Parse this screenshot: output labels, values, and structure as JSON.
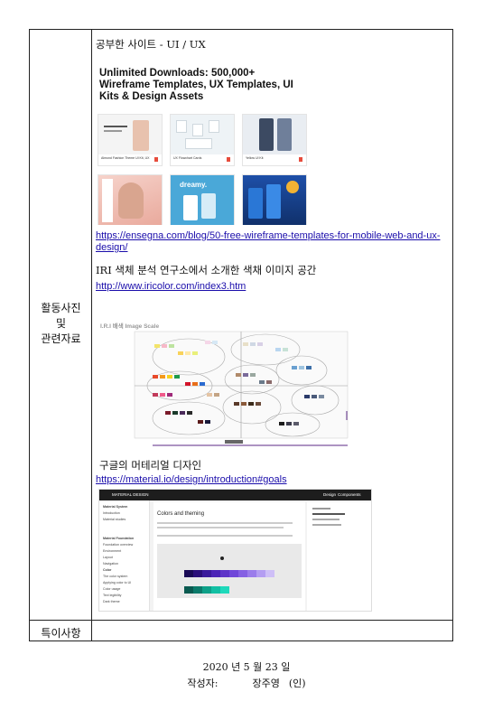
{
  "table": {
    "row_label": [
      "활동사진",
      "및",
      "관련자료"
    ],
    "special_label": "특이사항"
  },
  "section1": {
    "title": "공부한 사이트 - UI / UX",
    "screenshot_heading": "Unlimited Downloads: 500,000+ Wireframe Templates, UX Templates, UI Kits & Design Assets",
    "tiles": [
      {
        "caption": "Almond Fashion Theme UI Kit, UX",
        "color": "#f5d8c8"
      },
      {
        "caption": "UX Flowchart Cards",
        "color": "#eef3f6"
      },
      {
        "caption": "Yellow UI Kit",
        "color": "#6f7f9a"
      },
      {
        "caption": "",
        "color": "#f2c9c0"
      },
      {
        "caption": "dreamy.",
        "color": "#4aa8d8"
      },
      {
        "caption": "",
        "color": "#1e4fa8"
      }
    ],
    "url": "https://ensegna.com/blog/50-free-wireframe-templates-for-mobile-web-and-ux-design/"
  },
  "section2": {
    "title": "IRI 색체 분석 연구소에서 소개한 색채 이미지 공간",
    "url": "http://www.iricolor.com/index3.htm",
    "image_title": "I.R.I 배색 Image Scale"
  },
  "section3": {
    "title": "구글의 머테리얼 디자인",
    "url": "https://material.io/design/introduction#goals",
    "topbar_left": "MATERIAL DESIGN",
    "topbar_right": [
      "Design",
      "Components"
    ],
    "sidebar": [
      "Material System",
      "Introduction",
      "Material studies",
      "Material Foundation",
      "Foundation overview",
      "Environment",
      "Layout",
      "Navigation",
      "Color",
      "The color system",
      "Applying color to UI",
      "Color usage",
      "Text legibility",
      "Dark theme"
    ],
    "main_title": "Colors and theming",
    "palette_colors": [
      "#1a0a55",
      "#2b0f7a",
      "#3b1a9c",
      "#4b24b6",
      "#5e35c8",
      "#7047d9",
      "#8560e3",
      "#9b7ceb",
      "#b49df2",
      "#cebff7",
      "#0a5a50",
      "#0c7a6a",
      "#0ea088",
      "#12bfa3",
      "#1fd9bb"
    ]
  },
  "footer": {
    "date": "2020 년  5 월  23 일",
    "writer_label": "작성자:",
    "writer_name": "장주영",
    "seal": "(인)"
  },
  "colors": {
    "link": "#1a0dab",
    "border": "#222222"
  }
}
